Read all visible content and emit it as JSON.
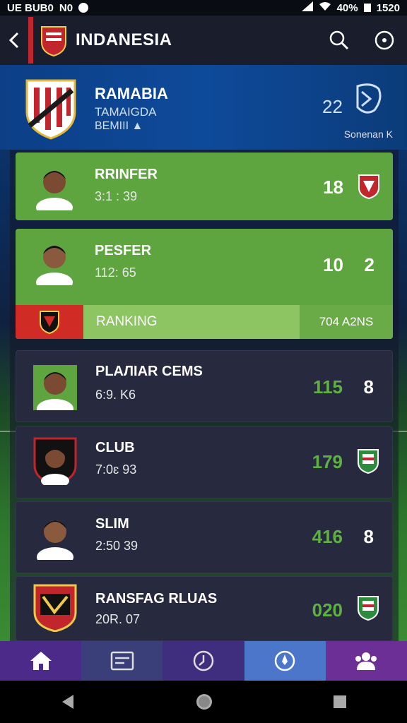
{
  "status_bar": {
    "left_text": "UE BUB0",
    "left_icon": "N0",
    "battery": "40%",
    "time": "1520"
  },
  "app_bar": {
    "title": "INDANESIA"
  },
  "team": {
    "name": "RAMABIA",
    "sub1": "TAMAIGDA",
    "sub2": "BEMIII ▲",
    "score": "22",
    "season": "Sonenan K"
  },
  "players": [
    {
      "name": "RRINFER",
      "time": "3:1 : 39",
      "score": "18",
      "style": "green",
      "score_color": "#ffffff",
      "right": "badge"
    },
    {
      "name": "PESFER",
      "time": "112:  65",
      "score": "10",
      "style": "green",
      "score_color": "#ffffff",
      "right": "2"
    },
    {
      "name": "PLAЛIAR CEMS",
      "time": "6:9.  K6",
      "score": "115",
      "style": "dark",
      "score_color": "#5fb043",
      "right": "8"
    },
    {
      "name": "CLUB",
      "time": "7:0ɛ 93",
      "score": "179",
      "style": "dark",
      "score_color": "#5fb043",
      "right": "badge"
    },
    {
      "name": "SLIM",
      "time": "2:50  39",
      "score": "416",
      "style": "dark",
      "score_color": "#5fb043",
      "right": "8"
    },
    {
      "name": "RANSFAG RLUAS",
      "time": "20R.  07",
      "score": "020",
      "style": "dark",
      "score_color": "#5fb043",
      "right": "badge"
    }
  ],
  "ranking": {
    "label": "RANKING",
    "value": "704 A2NS"
  },
  "colors": {
    "green_card": "#5ea540",
    "dark_card": "#272a3f",
    "accent_red": "#c0262c"
  },
  "bottom_nav": [
    {
      "icon": "home-icon",
      "bg": "#4b2a8a"
    },
    {
      "icon": "card-icon",
      "bg": "#3a3f7a"
    },
    {
      "icon": "clock-icon",
      "bg": "#3f2e7e"
    },
    {
      "icon": "compass-icon",
      "bg": "#4b76c9"
    },
    {
      "icon": "team-icon",
      "bg": "#6b2f95"
    }
  ]
}
